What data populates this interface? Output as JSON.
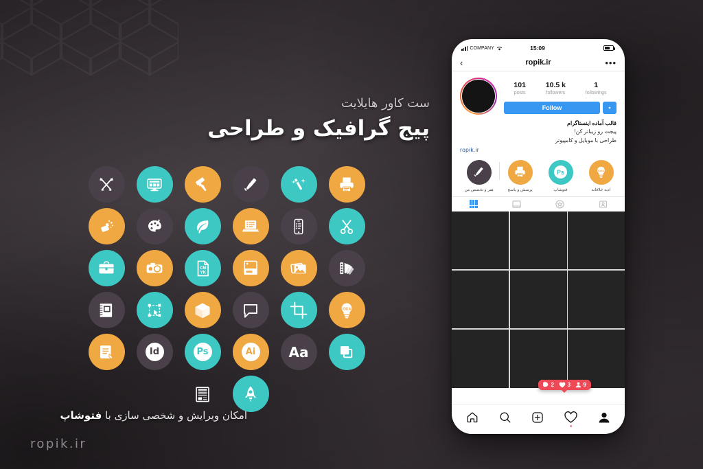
{
  "background": {
    "hex_color": "#3a3338",
    "accent_teal": "#3dc8c3",
    "accent_orange": "#f0a843",
    "accent_dark": "#494049"
  },
  "headline": {
    "subtitle": "ست کاور هایلایت",
    "title": "پیج گرافیک و طراحی"
  },
  "caption": {
    "text_before": "امکان ویرایش و شخصی سازی با ",
    "text_bold": "فتوشاپ"
  },
  "watermark": {
    "text": "ropik.ir"
  },
  "icon_grid": {
    "rows": [
      [
        {
          "name": "pencil-ruler-icon",
          "color": "dark"
        },
        {
          "name": "desktop-webdesign-icon",
          "color": "teal"
        },
        {
          "name": "paint-roller-icon",
          "color": "orange"
        },
        {
          "name": "paintbrush-icon",
          "color": "dark"
        },
        {
          "name": "magic-wand-icon",
          "color": "teal"
        },
        {
          "name": "printer-icon",
          "color": "orange"
        }
      ],
      [
        {
          "name": "spray-paint-icon",
          "color": "orange"
        },
        {
          "name": "palette-icon",
          "color": "dark"
        },
        {
          "name": "leaf-icon",
          "color": "teal"
        },
        {
          "name": "laptop-list-icon",
          "color": "orange"
        },
        {
          "name": "mobile-phone-icon",
          "color": "dark"
        },
        {
          "name": "scissors-icon",
          "color": "teal"
        }
      ],
      [
        {
          "name": "briefcase-icon",
          "color": "teal"
        },
        {
          "name": "camera-icon",
          "color": "orange"
        },
        {
          "name": "cmyk-file-icon",
          "color": "teal"
        },
        {
          "name": "business-card-icon",
          "color": "orange"
        },
        {
          "name": "photos-stack-icon",
          "color": "orange"
        },
        {
          "name": "color-swatch-fan-icon",
          "color": "dark"
        }
      ],
      [
        {
          "name": "notebook-icon",
          "color": "dark"
        },
        {
          "name": "vector-nodes-icon",
          "color": "teal"
        },
        {
          "name": "3d-box-icon",
          "color": "orange"
        },
        {
          "name": "speech-bubble-icon",
          "color": "dark"
        },
        {
          "name": "crop-tool-icon",
          "color": "teal"
        },
        {
          "name": "idea-lightbulb-icon",
          "color": "orange"
        }
      ],
      [
        {
          "name": "document-edit-icon",
          "color": "orange"
        },
        {
          "name": "indesign-id-icon",
          "color": "dark",
          "glyph": "Id"
        },
        {
          "name": "photoshop-ps-icon",
          "color": "teal",
          "glyph": "Ps"
        },
        {
          "name": "illustrator-ai-icon",
          "color": "orange",
          "glyph": "Ai"
        },
        {
          "name": "typography-aa-icon",
          "color": "dark",
          "glyph": "Aa"
        },
        {
          "name": "layers-squares-icon",
          "color": "teal"
        }
      ],
      [
        {
          "name": "empty-slot",
          "color": "none"
        },
        {
          "name": "empty-slot",
          "color": "none"
        },
        {
          "name": "newspaper-icon",
          "color": "none"
        },
        {
          "name": "rocket-launch-icon",
          "color": "teal"
        },
        {
          "name": "empty-slot",
          "color": "none"
        },
        {
          "name": "empty-slot",
          "color": "none"
        }
      ]
    ]
  },
  "phone": {
    "status_bar": {
      "carrier": "COMPANY",
      "time": "15:09"
    },
    "nav": {
      "title": "ropik.ir",
      "back_icon": "‹",
      "more_icon": "•••"
    },
    "profile": {
      "stats": [
        {
          "number": "101",
          "label": "posts"
        },
        {
          "number": "10.5 k",
          "label": "followers"
        },
        {
          "number": "1",
          "label": "followings"
        }
      ],
      "follow_button": "Follow",
      "follow_caret": "▾"
    },
    "bio": {
      "line1": "قالب آماده اینستاگرام",
      "line2": "پیجت رو زیباتر کن!",
      "line3": "طراحی با موبایل و کامپیوتر",
      "link": "ropik.ir"
    },
    "highlights": [
      {
        "label": "هنر و تخصص من",
        "icon": "paintbrush-icon",
        "color": "dark"
      },
      {
        "label": "پرسش و پاسخ",
        "icon": "printer-icon",
        "color": "orange"
      },
      {
        "label": "فتوشاپ",
        "icon": "photoshop-ps-icon",
        "color": "teal",
        "glyph": "Ps"
      },
      {
        "label": "ادیه خلاقانه",
        "icon": "idea-lightbulb-icon",
        "color": "orange"
      },
      {
        "label": "",
        "icon": "partial-highlight-icon",
        "color": "teal"
      }
    ],
    "tabs": [
      {
        "name": "grid-tab",
        "active": true
      },
      {
        "name": "reels-tab",
        "active": false
      },
      {
        "name": "saved-star-tab",
        "active": false
      },
      {
        "name": "tagged-tab",
        "active": false
      }
    ],
    "posts_count": 9,
    "notification": {
      "comments": "2",
      "likes": "3",
      "followers": "9"
    },
    "bottom_nav": [
      "home-icon",
      "search-icon",
      "add-post-icon",
      "activity-heart-icon",
      "profile-icon"
    ]
  }
}
